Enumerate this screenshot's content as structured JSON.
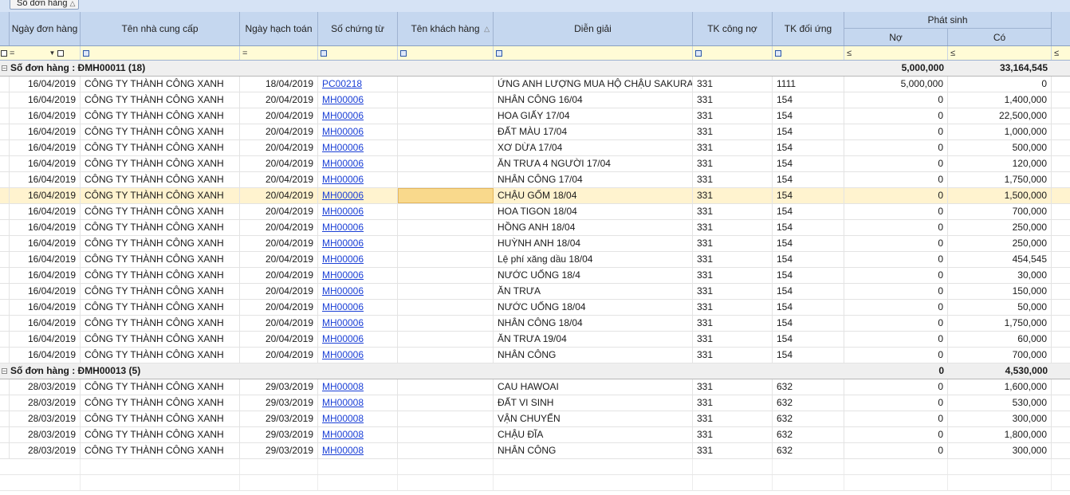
{
  "group_panel": {
    "chip_label": "Số đơn hàng",
    "sort_glyph": "△"
  },
  "columns": {
    "ngay_don_hang": "Ngày đơn hàng",
    "ten_ncc": "Tên nhà cung cấp",
    "ngay_hach_toan": "Ngày hạch toán",
    "so_chung_tu": "Số chứng từ",
    "ten_khach_hang": "Tên khách hàng",
    "dien_giai": "Diễn giải",
    "tk_cong_no": "TK công nợ",
    "tk_doi_ung": "TK đối ứng",
    "phat_sinh": "Phát sinh",
    "no": "Nợ",
    "co": "Có",
    "sort_glyph": "△"
  },
  "filter": {
    "eq": "=",
    "le": "≤",
    "dropdown": "▼"
  },
  "groups": [
    {
      "label": "Số đơn hàng : ĐMH00011 (18)",
      "total_no": "5,000,000",
      "total_co": "33,164,545",
      "rows": [
        {
          "ngay": "16/04/2019",
          "ncc": "CÔNG TY THÀNH CÔNG XANH",
          "hach_toan": "18/04/2019",
          "chung_tu": "PC00218",
          "kh": "",
          "dien_giai": "ỨNG ANH LƯỢNG MUA HỘ CHẬU SAKURA",
          "tk_no": "331",
          "tk_du": "1111",
          "no": "5,000,000",
          "co": "0"
        },
        {
          "ngay": "16/04/2019",
          "ncc": "CÔNG TY THÀNH CÔNG XANH",
          "hach_toan": "20/04/2019",
          "chung_tu": "MH00006",
          "kh": "",
          "dien_giai": "NHÂN CÔNG 16/04",
          "tk_no": "331",
          "tk_du": "154",
          "no": "0",
          "co": "1,400,000"
        },
        {
          "ngay": "16/04/2019",
          "ncc": "CÔNG TY THÀNH CÔNG XANH",
          "hach_toan": "20/04/2019",
          "chung_tu": "MH00006",
          "kh": "",
          "dien_giai": "HOA GIẤY 17/04",
          "tk_no": "331",
          "tk_du": "154",
          "no": "0",
          "co": "22,500,000"
        },
        {
          "ngay": "16/04/2019",
          "ncc": "CÔNG TY THÀNH CÔNG XANH",
          "hach_toan": "20/04/2019",
          "chung_tu": "MH00006",
          "kh": "",
          "dien_giai": "ĐẤT MÀU 17/04",
          "tk_no": "331",
          "tk_du": "154",
          "no": "0",
          "co": "1,000,000"
        },
        {
          "ngay": "16/04/2019",
          "ncc": "CÔNG TY THÀNH CÔNG XANH",
          "hach_toan": "20/04/2019",
          "chung_tu": "MH00006",
          "kh": "",
          "dien_giai": "XƠ DỪA 17/04",
          "tk_no": "331",
          "tk_du": "154",
          "no": "0",
          "co": "500,000"
        },
        {
          "ngay": "16/04/2019",
          "ncc": "CÔNG TY THÀNH CÔNG XANH",
          "hach_toan": "20/04/2019",
          "chung_tu": "MH00006",
          "kh": "",
          "dien_giai": "ĂN TRƯA 4 NGƯỜI 17/04",
          "tk_no": "331",
          "tk_du": "154",
          "no": "0",
          "co": "120,000"
        },
        {
          "ngay": "16/04/2019",
          "ncc": "CÔNG TY THÀNH CÔNG XANH",
          "hach_toan": "20/04/2019",
          "chung_tu": "MH00006",
          "kh": "",
          "dien_giai": "NHÂN CÔNG 17/04",
          "tk_no": "331",
          "tk_du": "154",
          "no": "0",
          "co": "1,750,000"
        },
        {
          "ngay": "16/04/2019",
          "ncc": "CÔNG TY THÀNH CÔNG XANH",
          "hach_toan": "20/04/2019",
          "chung_tu": "MH00006",
          "kh": "",
          "dien_giai": "CHẬU GỐM 18/04",
          "tk_no": "331",
          "tk_du": "154",
          "no": "0",
          "co": "1,500,000",
          "selected": true
        },
        {
          "ngay": "16/04/2019",
          "ncc": "CÔNG TY THÀNH CÔNG XANH",
          "hach_toan": "20/04/2019",
          "chung_tu": "MH00006",
          "kh": "",
          "dien_giai": "HOA TIGON 18/04",
          "tk_no": "331",
          "tk_du": "154",
          "no": "0",
          "co": "700,000"
        },
        {
          "ngay": "16/04/2019",
          "ncc": "CÔNG TY THÀNH CÔNG XANH",
          "hach_toan": "20/04/2019",
          "chung_tu": "MH00006",
          "kh": "",
          "dien_giai": "HỒNG ANH 18/04",
          "tk_no": "331",
          "tk_du": "154",
          "no": "0",
          "co": "250,000"
        },
        {
          "ngay": "16/04/2019",
          "ncc": "CÔNG TY THÀNH CÔNG XANH",
          "hach_toan": "20/04/2019",
          "chung_tu": "MH00006",
          "kh": "",
          "dien_giai": "HUỲNH ANH 18/04",
          "tk_no": "331",
          "tk_du": "154",
          "no": "0",
          "co": "250,000"
        },
        {
          "ngay": "16/04/2019",
          "ncc": "CÔNG TY THÀNH CÔNG XANH",
          "hach_toan": "20/04/2019",
          "chung_tu": "MH00006",
          "kh": "",
          "dien_giai": "Lệ phí xăng dầu 18/04",
          "tk_no": "331",
          "tk_du": "154",
          "no": "0",
          "co": "454,545"
        },
        {
          "ngay": "16/04/2019",
          "ncc": "CÔNG TY THÀNH CÔNG XANH",
          "hach_toan": "20/04/2019",
          "chung_tu": "MH00006",
          "kh": "",
          "dien_giai": "NƯỚC UỐNG  18/4",
          "tk_no": "331",
          "tk_du": "154",
          "no": "0",
          "co": "30,000"
        },
        {
          "ngay": "16/04/2019",
          "ncc": "CÔNG TY THÀNH CÔNG XANH",
          "hach_toan": "20/04/2019",
          "chung_tu": "MH00006",
          "kh": "",
          "dien_giai": "ĂN TRƯA",
          "tk_no": "331",
          "tk_du": "154",
          "no": "0",
          "co": "150,000"
        },
        {
          "ngay": "16/04/2019",
          "ncc": "CÔNG TY THÀNH CÔNG XANH",
          "hach_toan": "20/04/2019",
          "chung_tu": "MH00006",
          "kh": "",
          "dien_giai": "NƯỚC UỐNG 18/04",
          "tk_no": "331",
          "tk_du": "154",
          "no": "0",
          "co": "50,000"
        },
        {
          "ngay": "16/04/2019",
          "ncc": "CÔNG TY THÀNH CÔNG XANH",
          "hach_toan": "20/04/2019",
          "chung_tu": "MH00006",
          "kh": "",
          "dien_giai": "NHÂN CÔNG 18/04",
          "tk_no": "331",
          "tk_du": "154",
          "no": "0",
          "co": "1,750,000"
        },
        {
          "ngay": "16/04/2019",
          "ncc": "CÔNG TY THÀNH CÔNG XANH",
          "hach_toan": "20/04/2019",
          "chung_tu": "MH00006",
          "kh": "",
          "dien_giai": "ĂN TRƯA 19/04",
          "tk_no": "331",
          "tk_du": "154",
          "no": "0",
          "co": "60,000"
        },
        {
          "ngay": "16/04/2019",
          "ncc": "CÔNG TY THÀNH CÔNG XANH",
          "hach_toan": "20/04/2019",
          "chung_tu": "MH00006",
          "kh": "",
          "dien_giai": "NHÂN CÔNG",
          "tk_no": "331",
          "tk_du": "154",
          "no": "0",
          "co": "700,000"
        }
      ]
    },
    {
      "label": "Số đơn hàng : ĐMH00013 (5)",
      "total_no": "0",
      "total_co": "4,530,000",
      "rows": [
        {
          "ngay": "28/03/2019",
          "ncc": "CÔNG TY THÀNH CÔNG XANH",
          "hach_toan": "29/03/2019",
          "chung_tu": "MH00008",
          "kh": "",
          "dien_giai": "CAU HAWOAI",
          "tk_no": "331",
          "tk_du": "632",
          "no": "0",
          "co": "1,600,000"
        },
        {
          "ngay": "28/03/2019",
          "ncc": "CÔNG TY THÀNH CÔNG XANH",
          "hach_toan": "29/03/2019",
          "chung_tu": "MH00008",
          "kh": "",
          "dien_giai": "ĐẤT VI SINH",
          "tk_no": "331",
          "tk_du": "632",
          "no": "0",
          "co": "530,000"
        },
        {
          "ngay": "28/03/2019",
          "ncc": "CÔNG TY THÀNH CÔNG XANH",
          "hach_toan": "29/03/2019",
          "chung_tu": "MH00008",
          "kh": "",
          "dien_giai": "VẬN CHUYỂN",
          "tk_no": "331",
          "tk_du": "632",
          "no": "0",
          "co": "300,000"
        },
        {
          "ngay": "28/03/2019",
          "ncc": "CÔNG TY THÀNH CÔNG XANH",
          "hach_toan": "29/03/2019",
          "chung_tu": "MH00008",
          "kh": "",
          "dien_giai": "CHẬU ĐĨA",
          "tk_no": "331",
          "tk_du": "632",
          "no": "0",
          "co": "1,800,000"
        },
        {
          "ngay": "28/03/2019",
          "ncc": "CÔNG TY THÀNH CÔNG XANH",
          "hach_toan": "29/03/2019",
          "chung_tu": "MH00008",
          "kh": "",
          "dien_giai": "NHÂN CÔNG",
          "tk_no": "331",
          "tk_du": "632",
          "no": "0",
          "co": "300,000"
        }
      ]
    }
  ],
  "colors": {
    "header_bg": "#c5d7ef",
    "filter_bg": "#fffbd6",
    "link": "#1a3fd6",
    "selected_row": "#fff3cf"
  }
}
